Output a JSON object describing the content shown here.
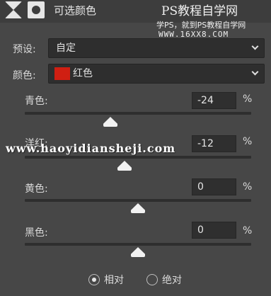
{
  "header": {
    "title": "可选颜色",
    "watermark_brand": "PS教程自学网",
    "watermark_tagline": "学PS，就到PS教程自学网",
    "watermark_url": "WWW.16XX8.COM"
  },
  "preset": {
    "label": "预设:",
    "value": "自定"
  },
  "colors": {
    "label": "颜色:",
    "value": "红色",
    "swatch_color": "#d01f12"
  },
  "sliders": [
    {
      "label": "青色:",
      "value": "-24",
      "unit": "%",
      "position": 0.38
    },
    {
      "label": "洋红:",
      "value": "-12",
      "unit": "%",
      "position": 0.44
    },
    {
      "label": "黄色:",
      "value": "0",
      "unit": "%",
      "position": 0.5
    },
    {
      "label": "黑色:",
      "value": "0",
      "unit": "%",
      "position": 0.5
    }
  ],
  "overlay_watermark": "www.haoyidiansheji.com",
  "method": {
    "options": [
      "相对",
      "绝对"
    ],
    "selected": "相对"
  }
}
